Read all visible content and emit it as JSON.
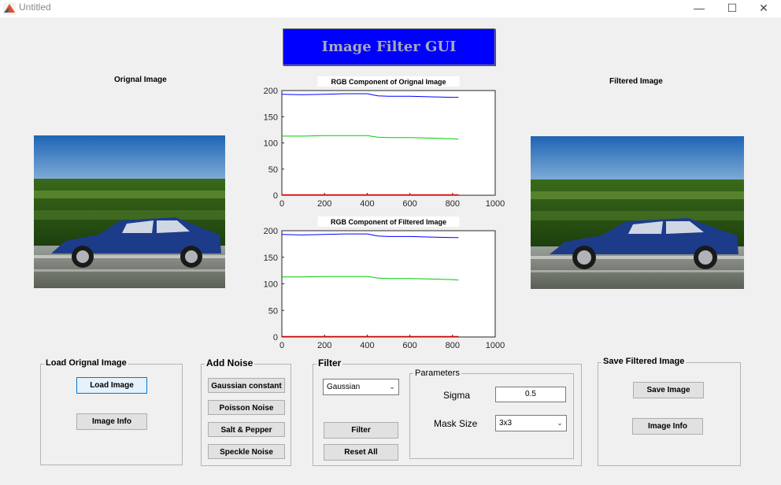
{
  "window": {
    "title": "Untitled",
    "controls": {
      "minimize": "—",
      "maximize": "☐",
      "close": "✕"
    }
  },
  "gui_title": "Image Filter GUI",
  "original_label": "Orignal Image",
  "filtered_label": "Filtered Image",
  "chart_data": [
    {
      "type": "line",
      "title": "RGB Component of Orignal Image",
      "xlim": [
        0,
        1000
      ],
      "ylim": [
        0,
        200
      ],
      "x_ticks": [
        "0",
        "200",
        "400",
        "600",
        "800",
        "1000"
      ],
      "y_ticks": [
        "0",
        "50",
        "100",
        "150",
        "200"
      ],
      "series": [
        {
          "color": "#0000ff",
          "x": [
            0,
            100,
            200,
            300,
            400,
            450,
            500,
            600,
            700,
            800,
            828
          ],
          "y": [
            193,
            192,
            193,
            194,
            194,
            190,
            189,
            189,
            188,
            187,
            187
          ]
        },
        {
          "color": "#00cc00",
          "x": [
            0,
            100,
            200,
            300,
            400,
            450,
            500,
            600,
            700,
            800,
            828
          ],
          "y": [
            113,
            113,
            114,
            114,
            114,
            111,
            110,
            110,
            109,
            108,
            107
          ]
        },
        {
          "color": "#ff0000",
          "x": [
            0,
            200,
            400,
            600,
            800,
            828
          ],
          "y": [
            1,
            1,
            1,
            1,
            1,
            1
          ]
        }
      ]
    },
    {
      "type": "line",
      "title": "RGB Component of Filtered Image",
      "xlim": [
        0,
        1000
      ],
      "ylim": [
        0,
        200
      ],
      "x_ticks": [
        "0",
        "200",
        "400",
        "600",
        "800",
        "1000"
      ],
      "y_ticks": [
        "0",
        "50",
        "100",
        "150",
        "200"
      ],
      "series": [
        {
          "color": "#0000ff",
          "x": [
            0,
            100,
            200,
            300,
            400,
            450,
            500,
            600,
            700,
            800,
            828
          ],
          "y": [
            193,
            192,
            193,
            194,
            194,
            190,
            189,
            189,
            188,
            187,
            187
          ]
        },
        {
          "color": "#00cc00",
          "x": [
            0,
            100,
            200,
            300,
            400,
            450,
            500,
            600,
            700,
            800,
            828
          ],
          "y": [
            113,
            113,
            114,
            114,
            114,
            111,
            110,
            110,
            109,
            108,
            107
          ]
        },
        {
          "color": "#ff0000",
          "x": [
            0,
            200,
            400,
            600,
            800,
            828
          ],
          "y": [
            1,
            1,
            1,
            1,
            1,
            1
          ]
        }
      ]
    }
  ],
  "load_panel": {
    "title": "Load Orignal Image",
    "load_button": "Load Image",
    "info_button": "Image Info"
  },
  "noise_panel": {
    "title": "Add Noise",
    "buttons": [
      "Gaussian constant",
      "Poisson Noise",
      "Salt & Pepper",
      "Speckle Noise"
    ]
  },
  "filter_panel": {
    "title": "Filter",
    "filter_type": "Gaussian",
    "filter_button": "Filter",
    "reset_button": "Reset All",
    "params": {
      "title": "Parameters",
      "sigma_label": "Sigma",
      "sigma_value": "0.5",
      "mask_label": "Mask Size",
      "mask_value": "3x3"
    }
  },
  "save_panel": {
    "title": "Save Filtered Image",
    "save_button": "Save Image",
    "info_button": "Image Info"
  }
}
